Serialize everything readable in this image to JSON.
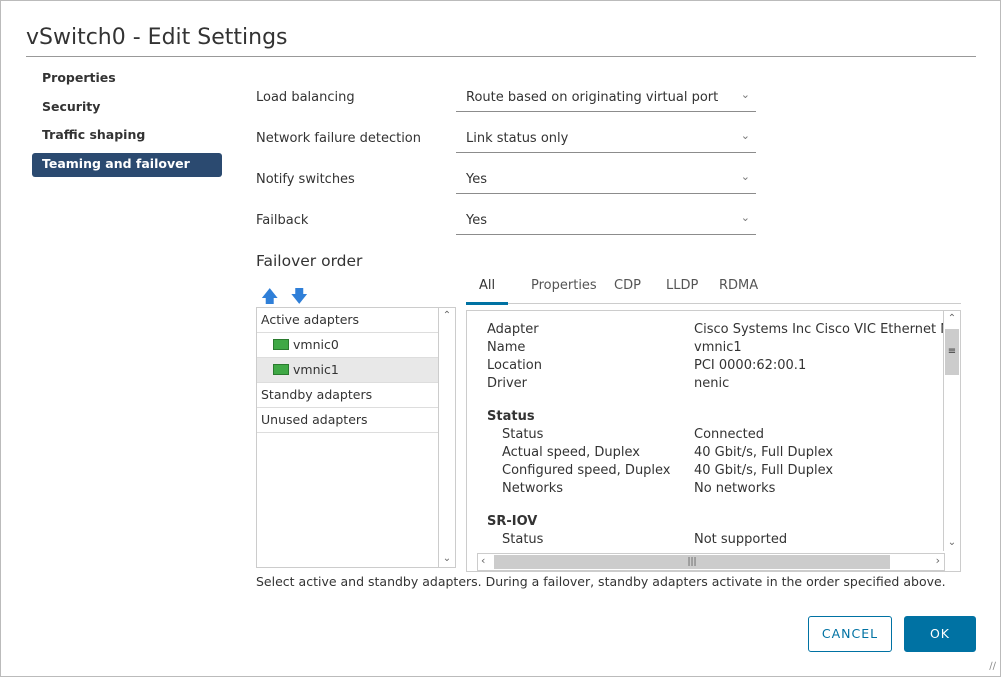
{
  "title": "vSwitch0 - Edit Settings",
  "nav": [
    "Properties",
    "Security",
    "Traffic shaping",
    "Teaming and failover"
  ],
  "fields": [
    {
      "label": "Load balancing",
      "value": "Route based on originating virtual port"
    },
    {
      "label": "Network failure detection",
      "value": "Link status only"
    },
    {
      "label": "Notify switches",
      "value": "Yes"
    },
    {
      "label": "Failback",
      "value": "Yes"
    }
  ],
  "failover": {
    "title": "Failover order",
    "groups": {
      "active": "Active adapters",
      "standby": "Standby adapters",
      "unused": "Unused adapters"
    },
    "active_nics": [
      "vmnic0",
      "vmnic1"
    ],
    "selected": "vmnic1"
  },
  "tabs": [
    "All",
    "Properties",
    "CDP",
    "LLDP",
    "RDMA"
  ],
  "details": {
    "adapter_k": "Adapter",
    "adapter_v": "Cisco Systems Inc Cisco VIC Ethernet NIC",
    "name_k": "Name",
    "name_v": "vmnic1",
    "location_k": "Location",
    "location_v": "PCI 0000:62:00.1",
    "driver_k": "Driver",
    "driver_v": "nenic",
    "status_h": "Status",
    "status_k": "Status",
    "status_v": "Connected",
    "actual_k": "Actual speed, Duplex",
    "actual_v": "40 Gbit/s, Full Duplex",
    "config_k": "Configured speed, Duplex",
    "config_v": "40 Gbit/s, Full Duplex",
    "networks_k": "Networks",
    "networks_v": "No networks",
    "sriov_h": "SR-IOV",
    "sriov_status_k": "Status",
    "sriov_status_v": "Not supported"
  },
  "help": "Select active and standby adapters. During a failover, standby adapters activate in the order specified above.",
  "buttons": {
    "cancel": "CANCEL",
    "ok": "OK"
  },
  "colors": {
    "accent": "#0072a3",
    "nav_selected": "#2b4a70"
  }
}
